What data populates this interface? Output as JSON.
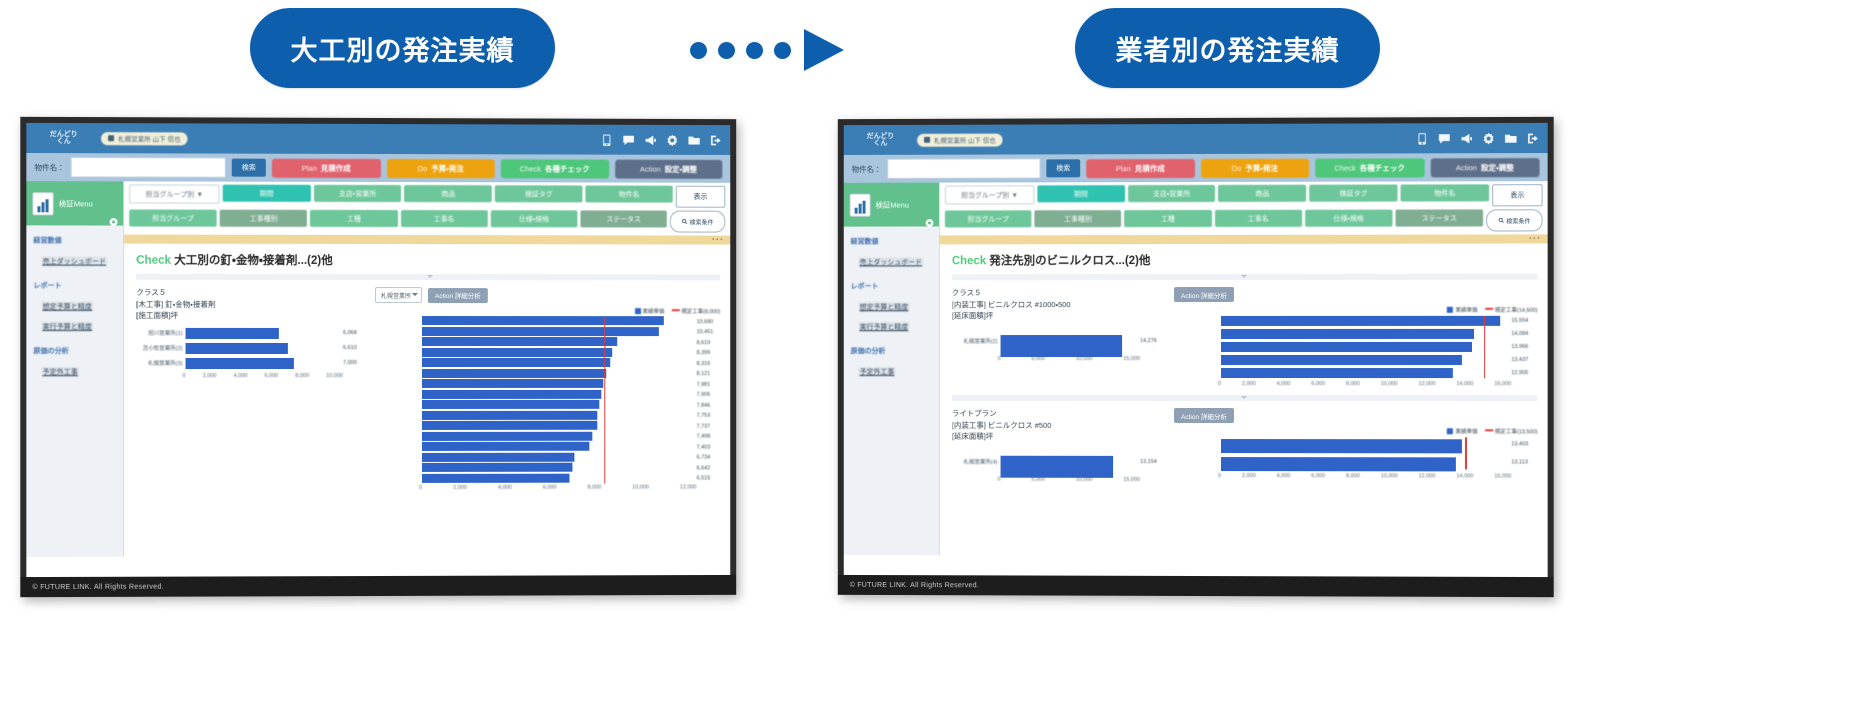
{
  "flow": {
    "left_pill": "大工別の発注実績",
    "right_pill": "業者別の発注実績",
    "arrow_dots": 4,
    "accent_color": "#0d5fae"
  },
  "windows": [
    {
      "id": "left",
      "appbar": {
        "logo_line1": "だんどり",
        "logo_line2": "くん",
        "user_chip": "札幌営業所  山下 信也",
        "icons": [
          "tablet-icon",
          "comment-icon",
          "megaphone-icon",
          "gear-icon",
          "folder-icon",
          "logout-icon"
        ]
      },
      "search": {
        "label": "物件名：",
        "value": "",
        "placeholder": "",
        "search_button": "検索"
      },
      "toolbar": [
        {
          "en": "Plan",
          "jp": "見積作成",
          "color": "#e0626c"
        },
        {
          "en": "Do",
          "jp": "予算・発注",
          "color": "#eda30f"
        },
        {
          "en": "Check",
          "jp": "各種チェック",
          "color": "#4ec77a"
        },
        {
          "en": "Action",
          "jp": "設定・調整",
          "color": "#5e6f8a"
        }
      ],
      "sidebar": {
        "menu_title": "検証Menu",
        "sections": [
          {
            "heading": "経営数値",
            "items": [
              "売上ダッシュボード"
            ]
          },
          {
            "heading": "レポート",
            "items": [
              "想定予算と精度",
              "実行予算と精度"
            ]
          },
          {
            "heading": "原価の分析",
            "items": [
              "予定外工事"
            ]
          }
        ]
      },
      "filters": {
        "row1": [
          "担当グループ別 ▼",
          "期間",
          "支店・営業所",
          "商品",
          "検証タグ",
          "物件名"
        ],
        "row2": [
          "担当グループ",
          "工事種別",
          "工種",
          "工事名",
          "仕様・規格",
          "ステータス"
        ],
        "show_button": "表示",
        "condition_button": "検索条件"
      },
      "content": {
        "title_tag": "Check",
        "title": "大工別の釘・金物・接着剤...(2)他",
        "meta": [
          "クラス５",
          "[木工事] 釘・金物・接着剤",
          "[施工面積]坪"
        ],
        "select_value": "札幌営業所",
        "action_badge": "Action 詳細分析",
        "left_chart": {
          "type": "bar",
          "categories": [
            "旭川営業所(1)",
            "苫小牧営業所(2)",
            "札幌営業所(3)"
          ],
          "values": [
            6068,
            6610,
            7000
          ],
          "value_labels": [
            "6,068",
            "6,610",
            "7,000"
          ],
          "xticks": [
            "0",
            "2,000",
            "4,000",
            "6,000",
            "8,000",
            "10,000"
          ],
          "xlim": [
            0,
            10000
          ]
        },
        "right_chart": {
          "type": "bar",
          "legend": [
            "実績単価",
            "規定工事(8,000)"
          ],
          "target_line": 8000,
          "values": [
            10680,
            10451,
            8619,
            8399,
            8316,
            8121,
            7981,
            7906,
            7846,
            7753,
            7737,
            7498,
            7403,
            6734,
            6642,
            6515
          ],
          "value_labels": [
            "10,680",
            "10,451",
            "8,619",
            "8,399",
            "8,316",
            "8,121",
            "7,981",
            "7,906",
            "7,846",
            "7,753",
            "7,737",
            "7,498",
            "7,403",
            "6,734",
            "6,642",
            "6,515"
          ],
          "xticks": [
            "0",
            "2,000",
            "4,000",
            "6,000",
            "8,000",
            "10,000",
            "12,000"
          ],
          "xlim": [
            0,
            12000
          ]
        }
      },
      "footer": "© FUTURE LINK. All Rights Reserved."
    },
    {
      "id": "right",
      "appbar": {
        "logo_line1": "だんどり",
        "logo_line2": "くん",
        "user_chip": "札幌営業所  山下 信也",
        "icons": [
          "tablet-icon",
          "comment-icon",
          "megaphone-icon",
          "gear-icon",
          "folder-icon",
          "logout-icon"
        ]
      },
      "search": {
        "label": "物件名：",
        "value": "",
        "placeholder": "",
        "search_button": "検索"
      },
      "toolbar": [
        {
          "en": "Plan",
          "jp": "見積作成",
          "color": "#e0626c"
        },
        {
          "en": "Do",
          "jp": "予算・発注",
          "color": "#eda30f"
        },
        {
          "en": "Check",
          "jp": "各種チェック",
          "color": "#4ec77a"
        },
        {
          "en": "Action",
          "jp": "設定・調整",
          "color": "#5e6f8a"
        }
      ],
      "sidebar": {
        "menu_title": "検証Menu",
        "sections": [
          {
            "heading": "経営数値",
            "items": [
              "売上ダッシュボード"
            ]
          },
          {
            "heading": "レポート",
            "items": [
              "想定予算と精度",
              "実行予算と精度"
            ]
          },
          {
            "heading": "原価の分析",
            "items": [
              "予定外工事"
            ]
          }
        ]
      },
      "filters": {
        "row1": [
          "担当グループ別 ▼",
          "期間",
          "支店・営業所",
          "商品",
          "検証タグ",
          "物件名"
        ],
        "row2": [
          "担当グループ",
          "工事種別",
          "工種",
          "工事名",
          "仕様・規格",
          "ステータス"
        ],
        "show_button": "表示",
        "condition_button": "検索条件"
      },
      "content": {
        "title_tag": "Check",
        "title": "発注先別のビニルクロス...(2)他",
        "block1": {
          "meta": [
            "クラス５",
            "[内装工事] ビニルクロス #1000・500",
            "[延床面積]坪"
          ],
          "action_badge": "Action 詳細分析",
          "left_chart": {
            "type": "bar",
            "categories": [
              "札幌営業所(2)"
            ],
            "values": [
              14276
            ],
            "value_labels": [
              "14,276"
            ],
            "xticks": [
              "0",
              "5,000",
              "10,000",
              "15,000"
            ],
            "xlim": [
              0,
              16000
            ]
          },
          "right_chart": {
            "type": "bar",
            "legend": [
              "実績単価",
              "規定工事(14,500)"
            ],
            "target_line": 14500,
            "values": [
              15554,
              14084,
              13966,
              13437,
              12905
            ],
            "value_labels": [
              "15,554",
              "14,084",
              "13,966",
              "13,437",
              "12,905"
            ],
            "xticks": [
              "0",
              "2,000",
              "4,000",
              "6,000",
              "8,000",
              "10,000",
              "12,000",
              "14,000",
              "16,000"
            ],
            "xlim": [
              0,
              16000
            ]
          }
        },
        "block2": {
          "meta": [
            "ライトプラン",
            "[内装工事] ビニルクロス #500",
            "[延床面積]坪"
          ],
          "action_badge": "Action 詳細分析",
          "left_chart": {
            "type": "bar",
            "categories": [
              "札幌営業所(4)"
            ],
            "values": [
              13154
            ],
            "value_labels": [
              "13,154"
            ],
            "xticks": [
              "0",
              "5,000",
              "10,000",
              "15,000"
            ],
            "xlim": [
              0,
              16000
            ]
          },
          "right_chart": {
            "type": "bar",
            "legend": [
              "実績単価",
              "規定工事(13,500)"
            ],
            "target_line": 13500,
            "values": [
              13403,
              13113
            ],
            "value_labels": [
              "13,403",
              "13,113"
            ],
            "xticks": [
              "0",
              "2,000",
              "4,000",
              "6,000",
              "8,000",
              "10,000",
              "12,000",
              "14,000",
              "16,000"
            ],
            "xlim": [
              0,
              16000
            ]
          }
        }
      },
      "footer": "© FUTURE LINK. All Rights Reserved."
    }
  ]
}
